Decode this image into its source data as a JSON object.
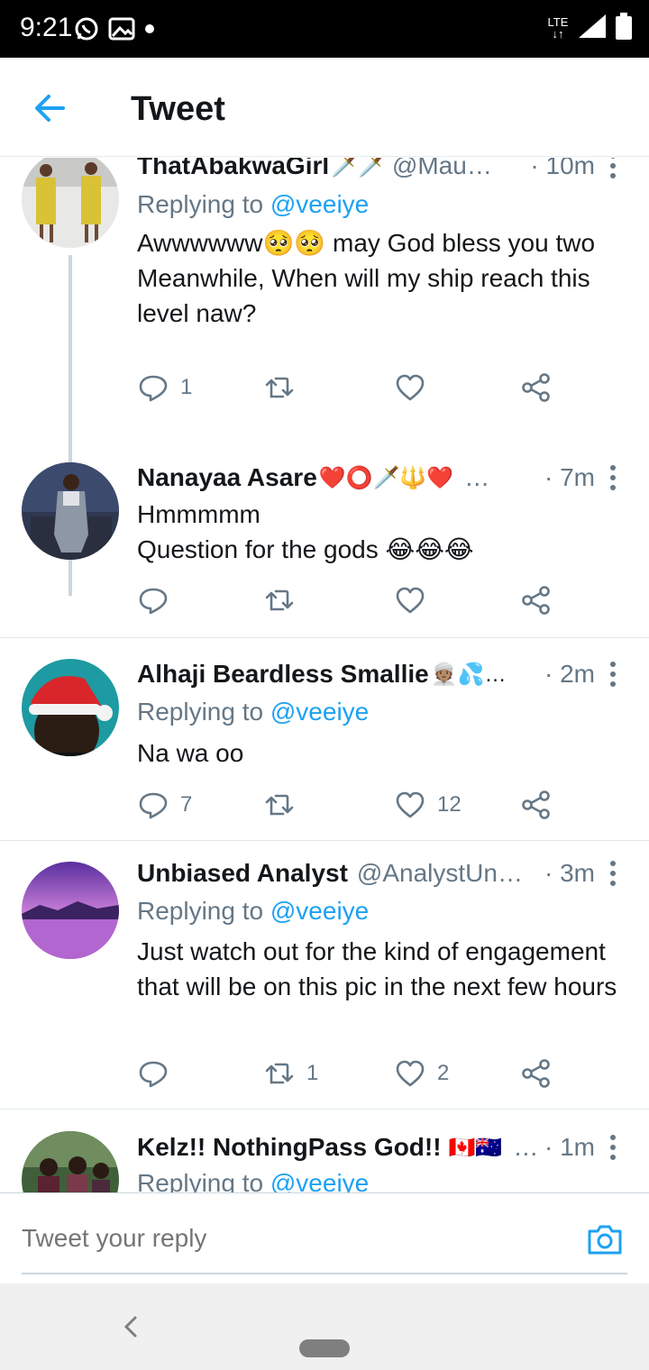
{
  "status_bar": {
    "time": "9:21",
    "network": "LTE"
  },
  "header": {
    "title": "Tweet"
  },
  "colors": {
    "accent": "#1da1f2",
    "muted": "#657786",
    "text": "#14171a"
  },
  "tweets": [
    {
      "name": "ThatAbakwaGirl",
      "name_emoji": "🗡️🗡️",
      "handle": "@Mau…",
      "time": "· 10m",
      "replying_prefix": "Replying to ",
      "replying_mention": "@veeiye",
      "body": "Awwwwww🥺🥺 may God bless you two\nMeanwhile, When will my ship reach this level naw?",
      "reply_count": "1",
      "retweet_count": "",
      "like_count": ""
    },
    {
      "name": "Nanayaa Asare",
      "name_emoji": "❤️⭕🗡️🔱❤️",
      "handle": "…",
      "time": "· 7m",
      "replying_prefix": "",
      "replying_mention": "",
      "body": "Hmmmmm\nQuestion for the gods 😂😂😂",
      "reply_count": "",
      "retweet_count": "",
      "like_count": ""
    },
    {
      "name": "Alhaji Beardless Smallie",
      "name_emoji": "👳🏽💦…",
      "handle": "",
      "time": "· 2m",
      "replying_prefix": "Replying to ",
      "replying_mention": "@veeiye",
      "body": "Na wa oo",
      "reply_count": "7",
      "retweet_count": "",
      "like_count": "12"
    },
    {
      "name": "Unbiased Analyst",
      "name_emoji": "",
      "handle": "@AnalystUn…",
      "time": "· 3m",
      "replying_prefix": "Replying to ",
      "replying_mention": "@veeiye",
      "body": "Just watch out for the kind of engagement that will be on this pic in the next few hours",
      "reply_count": "",
      "retweet_count": "1",
      "like_count": "2"
    },
    {
      "name": "Kelz!! NothingPass God!!",
      "name_emoji": "🇨🇦🇦🇺",
      "handle": "…",
      "time": "· 1m",
      "replying_prefix": "Replying to ",
      "replying_mention": "@veeiye",
      "body": "",
      "reply_count": "",
      "retweet_count": "",
      "like_count": ""
    }
  ],
  "reply_bar": {
    "placeholder": "Tweet your reply"
  },
  "icons": {
    "back": "arrow-left-icon",
    "reply": "comment-icon",
    "retweet": "retweet-icon",
    "like": "heart-icon",
    "share": "share-icon",
    "camera": "camera-icon"
  }
}
